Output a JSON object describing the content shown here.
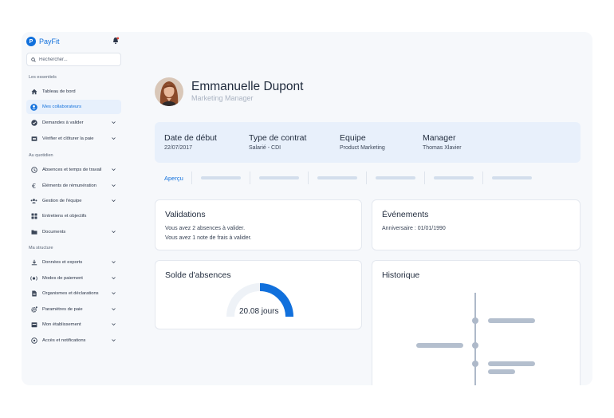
{
  "brand": {
    "name": "PayFit"
  },
  "search": {
    "placeholder": "Rechercher..."
  },
  "sidebar": {
    "sections": [
      {
        "label": "Les essentiels"
      },
      {
        "label": "Au quotidien"
      },
      {
        "label": "Ma structure"
      }
    ],
    "items": [
      {
        "label": "Tableau de bord",
        "icon": "home-icon"
      },
      {
        "label": "Mes collaborateurs",
        "icon": "user-circle-icon",
        "active": true
      },
      {
        "label": "Demandes à valider",
        "icon": "check-circle-icon"
      },
      {
        "label": "Vérifier et clôturer la paie",
        "icon": "payslip-icon"
      },
      {
        "label": "Absences et temps de travail",
        "icon": "clock-icon"
      },
      {
        "label": "Éléments de rémunération",
        "icon": "euro-icon"
      },
      {
        "label": "Gestion de l'équipe",
        "icon": "team-icon"
      },
      {
        "label": "Entretiens et objectifs",
        "icon": "grid-icon"
      },
      {
        "label": "Documents",
        "icon": "folder-icon"
      },
      {
        "label": "Données et exports",
        "icon": "download-icon"
      },
      {
        "label": "Modes de paiement",
        "icon": "payment-icon"
      },
      {
        "label": "Organismes et déclarations",
        "icon": "document-icon"
      },
      {
        "label": "Paramètres de paie",
        "icon": "settings-icon"
      },
      {
        "label": "Mon établissement",
        "icon": "building-icon"
      },
      {
        "label": "Accès et notifications",
        "icon": "access-icon"
      }
    ]
  },
  "profile": {
    "name": "Emmanuelle Dupont",
    "role": "Marketing Manager"
  },
  "info": [
    {
      "label": "Date de début",
      "value": "22/07/2017"
    },
    {
      "label": "Type de contrat",
      "value": "Salarié - CDI"
    },
    {
      "label": "Equipe",
      "value": "Product Marketing"
    },
    {
      "label": "Manager",
      "value": "Thomas Xlavier"
    }
  ],
  "tabs": {
    "active": "Aperçu"
  },
  "cards": {
    "validations": {
      "title": "Validations",
      "lines": [
        "Vous avez 2 absences à valider.",
        "Vous avez 1 note de frais à valider."
      ]
    },
    "events": {
      "title": "Événements",
      "lines": [
        "Anniversaire : 01/01/1990"
      ]
    },
    "absences": {
      "title": "Solde d'absences",
      "value": "20.08 jours",
      "fill_fraction": 0.5
    },
    "history": {
      "title": "Historique"
    }
  },
  "colors": {
    "accent": "#1170dc",
    "band": "#e8f0fb",
    "placeholder": "#d3deec"
  }
}
